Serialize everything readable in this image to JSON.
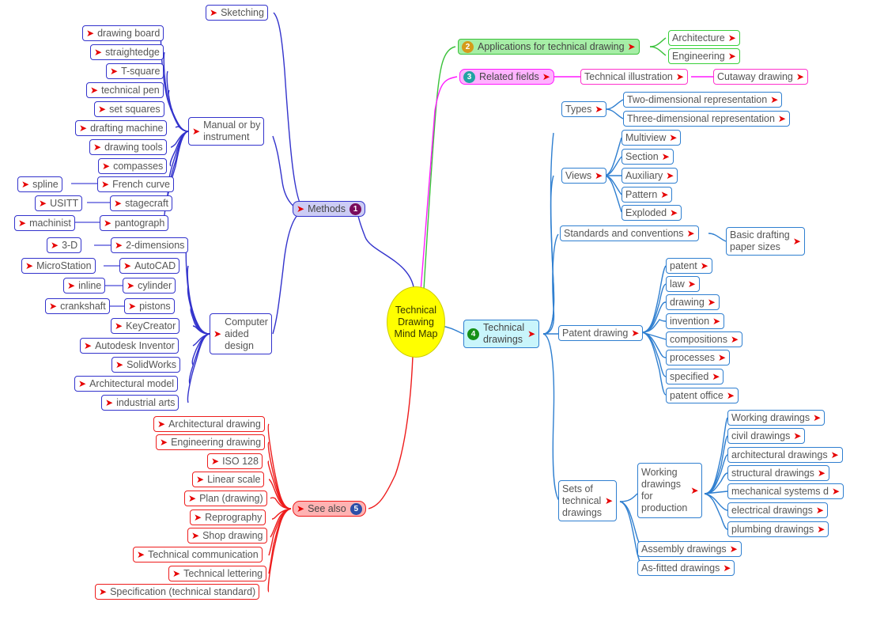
{
  "title": "Technical Drawing Mind Map",
  "center": {
    "label": "Technical\nDrawing\nMind Map",
    "fill": "#ffff00",
    "text_color": "#333300"
  },
  "icons": {
    "arrow": "➜",
    "arrow_name": "red-arrow-icon"
  },
  "branches": [
    {
      "id": "methods",
      "number": "1",
      "label": "Methods",
      "color": "#3333cc",
      "badge_color": "#7a0b5c",
      "children": [
        {
          "label": "Sketching",
          "children": []
        },
        {
          "label": "Manual or by\ninstrument",
          "children": [
            {
              "label": "drawing board"
            },
            {
              "label": "straightedge"
            },
            {
              "label": "T-square"
            },
            {
              "label": "technical pen"
            },
            {
              "label": "set squares"
            },
            {
              "label": "drafting machine"
            },
            {
              "label": "drawing tools"
            },
            {
              "label": "compasses"
            },
            {
              "label": "French curve",
              "sibling": "spline"
            },
            {
              "label": "stagecraft",
              "sibling": "USITT"
            },
            {
              "label": "pantograph",
              "sibling": "machinist"
            }
          ]
        },
        {
          "label": "Computer\naided\ndesign",
          "children": [
            {
              "label": "2-dimensions",
              "sibling": "3-D"
            },
            {
              "label": "AutoCAD",
              "sibling": "MicroStation"
            },
            {
              "label": "cylinder",
              "sibling": "inline"
            },
            {
              "label": "pistons",
              "sibling": "crankshaft"
            },
            {
              "label": "KeyCreator"
            },
            {
              "label": "Autodesk Inventor"
            },
            {
              "label": "SolidWorks"
            },
            {
              "label": "Architectural model"
            },
            {
              "label": "industrial arts"
            }
          ]
        }
      ]
    },
    {
      "id": "applications",
      "number": "2",
      "label": "Applications for technical drawing",
      "color": "#3cc13c",
      "badge_color": "#d59b1a",
      "children": [
        {
          "label": "Architecture"
        },
        {
          "label": "Engineering"
        }
      ]
    },
    {
      "id": "related",
      "number": "3",
      "label": "Related fields",
      "color": "#ff1aff",
      "badge_color": "#21a3a3",
      "children": [
        {
          "label": "Technical illustration",
          "children": [
            {
              "label": "Cutaway drawing"
            }
          ]
        }
      ]
    },
    {
      "id": "technical-drawings",
      "number": "4",
      "label": "Technical\ndrawings",
      "color": "#2f7fd0",
      "badge_color": "#169016",
      "children": [
        {
          "label": "Types",
          "children": [
            {
              "label": "Two-dimensional representation"
            },
            {
              "label": "Three-dimensional representation"
            }
          ]
        },
        {
          "label": "Views",
          "children": [
            {
              "label": "Multiview"
            },
            {
              "label": "Section"
            },
            {
              "label": "Auxiliary"
            },
            {
              "label": "Pattern"
            },
            {
              "label": "Exploded"
            }
          ]
        },
        {
          "label": "Standards and conventions",
          "children": [
            {
              "label": "Basic drafting\npaper sizes"
            }
          ]
        },
        {
          "label": "Patent drawing",
          "children": [
            {
              "label": "patent"
            },
            {
              "label": "law"
            },
            {
              "label": "drawing"
            },
            {
              "label": "invention"
            },
            {
              "label": "compositions"
            },
            {
              "label": "processes"
            },
            {
              "label": "specified"
            },
            {
              "label": "patent office"
            }
          ]
        },
        {
          "label": "Sets of\ntechnical\ndrawings",
          "children": [
            {
              "label": "Working\ndrawings\nfor\nproduction",
              "children": [
                {
                  "label": "Working drawings"
                },
                {
                  "label": "civil drawings"
                },
                {
                  "label": "architectural drawings"
                },
                {
                  "label": "structural drawings"
                },
                {
                  "label": "mechanical systems d"
                },
                {
                  "label": "electrical drawings"
                },
                {
                  "label": "plumbing drawings"
                }
              ]
            },
            {
              "label": "Assembly drawings"
            },
            {
              "label": "As-fitted drawings"
            }
          ]
        }
      ]
    },
    {
      "id": "see-also",
      "number": "5",
      "label": "See also",
      "color": "#ee1c1c",
      "badge_color": "#2b4fa8",
      "children": [
        {
          "label": "Architectural drawing"
        },
        {
          "label": "Engineering drawing"
        },
        {
          "label": "ISO 128"
        },
        {
          "label": "Linear scale"
        },
        {
          "label": "Plan (drawing)"
        },
        {
          "label": "Reprography"
        },
        {
          "label": "Shop drawing"
        },
        {
          "label": "Technical communication"
        },
        {
          "label": "Technical lettering"
        },
        {
          "label": "Specification (technical standard)"
        }
      ]
    }
  ],
  "nodes": {
    "sketching": "Sketching",
    "manual": "Manual or by\ninstrument",
    "cad": "Computer\naided\ndesign",
    "drawing_board": "drawing board",
    "straightedge": "straightedge",
    "tsquare": "T-square",
    "technical_pen": "technical pen",
    "set_squares": "set squares",
    "drafting_machine": "drafting machine",
    "drawing_tools": "drawing tools",
    "compasses": "compasses",
    "french_curve": "French curve",
    "spline": "spline",
    "stagecraft": "stagecraft",
    "usitt": "USITT",
    "pantograph": "pantograph",
    "machinist": "machinist",
    "two_dimensions": "2-dimensions",
    "three_d": "3-D",
    "autocad": "AutoCAD",
    "microstation": "MicroStation",
    "cylinder": "cylinder",
    "inline": "inline",
    "pistons": "pistons",
    "crankshaft": "crankshaft",
    "keycreator": "KeyCreator",
    "autodesk_inventor": "Autodesk Inventor",
    "solidworks": "SolidWorks",
    "architectural_model": "Architectural model",
    "industrial_arts": "industrial arts",
    "methods": "Methods",
    "applications": "Applications for technical drawing",
    "architecture": "Architecture",
    "engineering": "Engineering",
    "related_fields": "Related fields",
    "technical_illustration": "Technical illustration",
    "cutaway_drawing": "Cutaway drawing",
    "technical_drawings": "Technical\ndrawings",
    "types": "Types",
    "two_dim_rep": "Two-dimensional representation",
    "three_dim_rep": "Three-dimensional representation",
    "views": "Views",
    "multiview": "Multiview",
    "section": "Section",
    "auxiliary": "Auxiliary",
    "pattern": "Pattern",
    "exploded": "Exploded",
    "standards": "Standards and conventions",
    "basic_drafting": "Basic drafting\npaper sizes",
    "patent_drawing": "Patent drawing",
    "patent": "patent",
    "law": "law",
    "drawing": "drawing",
    "invention": "invention",
    "compositions": "compositions",
    "processes": "processes",
    "specified": "specified",
    "patent_office": "patent office",
    "sets_of": "Sets of\ntechnical\ndrawings",
    "working_for_production": "Working\ndrawings\nfor\nproduction",
    "working_drawings": "Working drawings",
    "civil_drawings": "civil drawings",
    "architectural_drawings": "architectural drawings",
    "structural_drawings": "structural drawings",
    "mechanical_systems": "mechanical systems d",
    "electrical_drawings": "electrical drawings",
    "plumbing_drawings": "plumbing drawings",
    "assembly_drawings": "Assembly drawings",
    "asfitted_drawings": "As-fitted drawings",
    "see_also": "See also",
    "arch_drawing": "Architectural drawing",
    "eng_drawing": "Engineering drawing",
    "iso128": "ISO 128",
    "linear_scale": "Linear scale",
    "plan_drawing": "Plan (drawing)",
    "reprography": "Reprography",
    "shop_drawing": "Shop drawing",
    "technical_communication": "Technical communication",
    "technical_lettering": "Technical lettering",
    "specification": "Specification (technical standard)"
  },
  "badges": {
    "one": "1",
    "two": "2",
    "three": "3",
    "four": "4",
    "five": "5"
  }
}
